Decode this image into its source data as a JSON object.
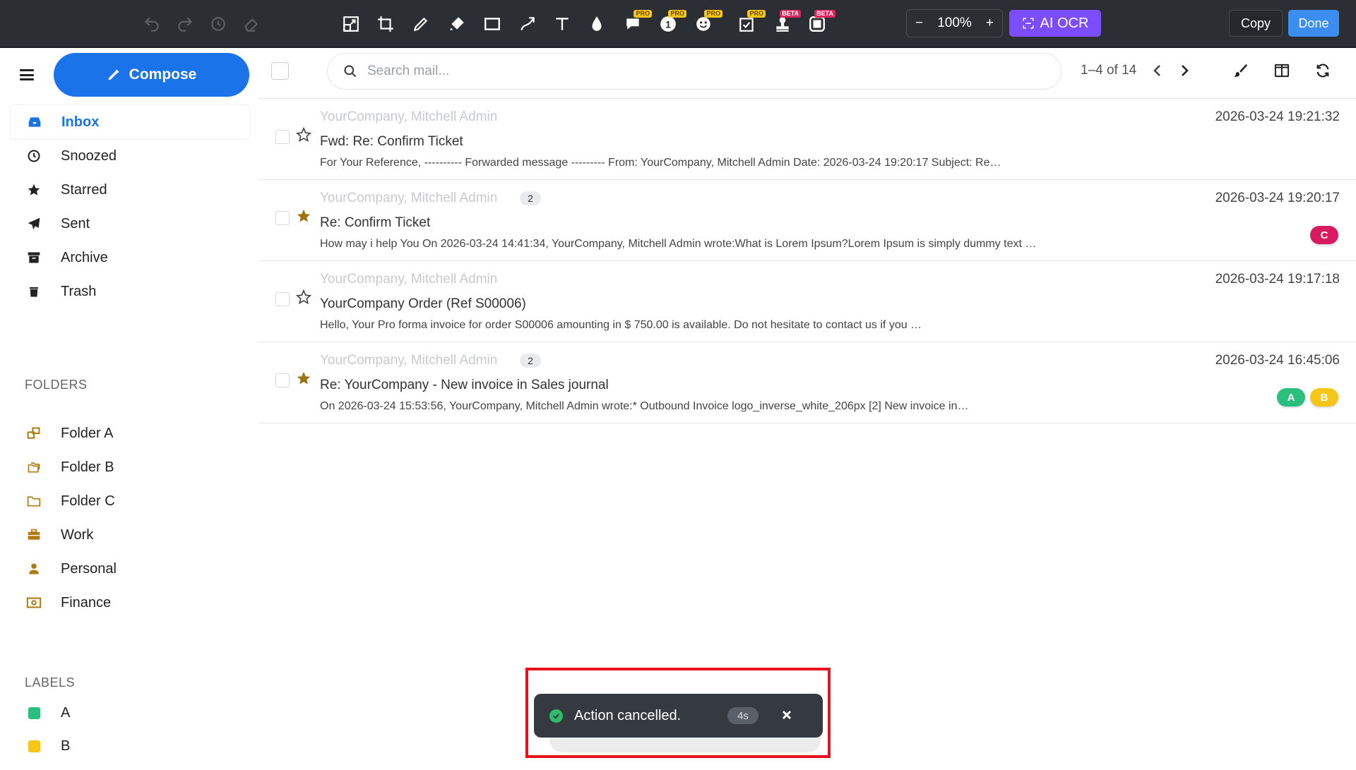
{
  "editor": {
    "zoom": "100%",
    "zoom_minus": "−",
    "zoom_plus": "+",
    "ai_ocr": "AI OCR",
    "copy": "Copy",
    "done": "Done",
    "pro": "PRO",
    "beta": "BETA"
  },
  "sidebar": {
    "compose": "Compose",
    "nav": [
      {
        "label": "Inbox",
        "icon": "inbox-icon"
      },
      {
        "label": "Snoozed",
        "icon": "clock-icon"
      },
      {
        "label": "Starred",
        "icon": "star-icon"
      },
      {
        "label": "Sent",
        "icon": "paper-plane-icon"
      },
      {
        "label": "Archive",
        "icon": "archive-icon"
      },
      {
        "label": "Trash",
        "icon": "trash-icon"
      }
    ],
    "folders_heading": "FOLDERS",
    "folders": [
      {
        "label": "Folder A",
        "icon": "folder-tree-icon"
      },
      {
        "label": "Folder B",
        "icon": "folder-copy-icon"
      },
      {
        "label": "Folder C",
        "icon": "folder-icon"
      },
      {
        "label": "Work",
        "icon": "briefcase-icon"
      },
      {
        "label": "Personal",
        "icon": "person-icon"
      },
      {
        "label": "Finance",
        "icon": "money-icon"
      }
    ],
    "labels_heading": "LABELS",
    "labels": [
      {
        "label": "A",
        "color": "#2bbf7e"
      },
      {
        "label": "B",
        "color": "#f5c518"
      }
    ]
  },
  "mail": {
    "search_placeholder": "Search mail...",
    "pager": "1–4 of 14",
    "rows": [
      {
        "sender": "YourCompany, Mitchell Admin",
        "count": "",
        "subject": "Fwd: Re: Confirm Ticket",
        "preview": "For Your Reference, ---------- Forwarded message --------- From: YourCompany, Mitchell Admin Date: 2026-03-24 19:20:17 Subject: Re…",
        "date": "2026-03-24 19:21:32",
        "starred": false
      },
      {
        "sender": "YourCompany, Mitchell Admin",
        "count": "2",
        "subject": "Re: Confirm Ticket",
        "preview": "How may i help You On 2026-03-24 14:41:34, YourCompany, Mitchell Admin wrote:What is Lorem Ipsum?Lorem Ipsum is simply dummy text …",
        "date": "2026-03-24 19:20:17",
        "starred": true,
        "tags": [
          {
            "text": "C",
            "color": "#d81b60"
          }
        ]
      },
      {
        "sender": "YourCompany, Mitchell Admin",
        "count": "",
        "subject": "YourCompany Order (Ref S00006)",
        "preview": "Hello, Your Pro forma invoice for order S00006 amounting in $ 750.00 is available. Do not hesitate to contact us if you …",
        "date": "2026-03-24 19:17:18",
        "starred": false
      },
      {
        "sender": "YourCompany, Mitchell Admin",
        "count": "2",
        "subject": "Re: YourCompany - New invoice in Sales journal",
        "preview": "On 2026-03-24 15:53:56, YourCompany, Mitchell Admin wrote:* Outbound Invoice logo_inverse_white_206px [2] New invoice in…",
        "date": "2026-03-24 16:45:06",
        "starred": true,
        "tags": [
          {
            "text": "A",
            "color": "#2bbf7e"
          },
          {
            "text": "B",
            "color": "#f5c518"
          }
        ]
      }
    ]
  },
  "toast": {
    "message": "Action cancelled.",
    "timer": "4s"
  }
}
